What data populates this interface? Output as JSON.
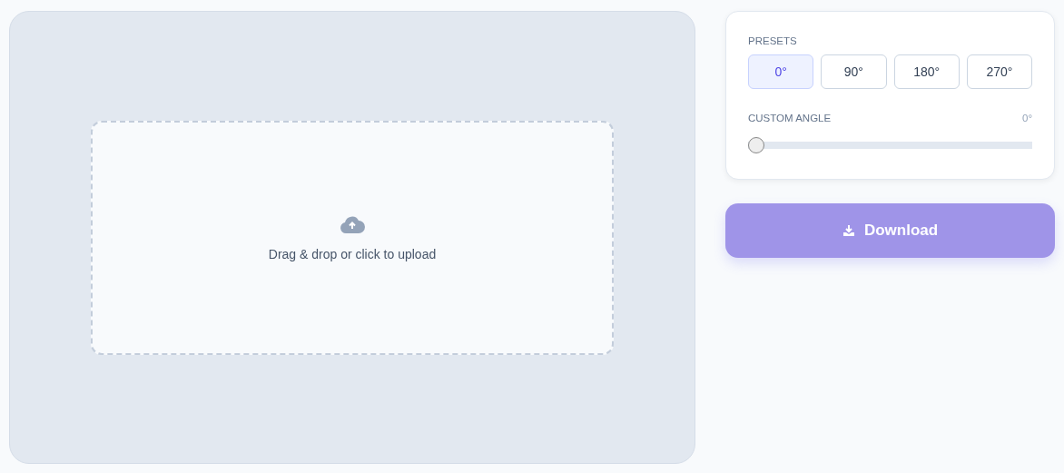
{
  "upload": {
    "label": "Drag & drop or click to upload"
  },
  "presets": {
    "title": "PRESETS",
    "items": [
      {
        "label": "0°",
        "selected": true
      },
      {
        "label": "90°",
        "selected": false
      },
      {
        "label": "180°",
        "selected": false
      },
      {
        "label": "270°",
        "selected": false
      }
    ]
  },
  "custom_angle": {
    "label": "CUSTOM ANGLE",
    "reading": "0°",
    "level": 0
  },
  "download_button": {
    "label": "Download",
    "disabled": true
  }
}
